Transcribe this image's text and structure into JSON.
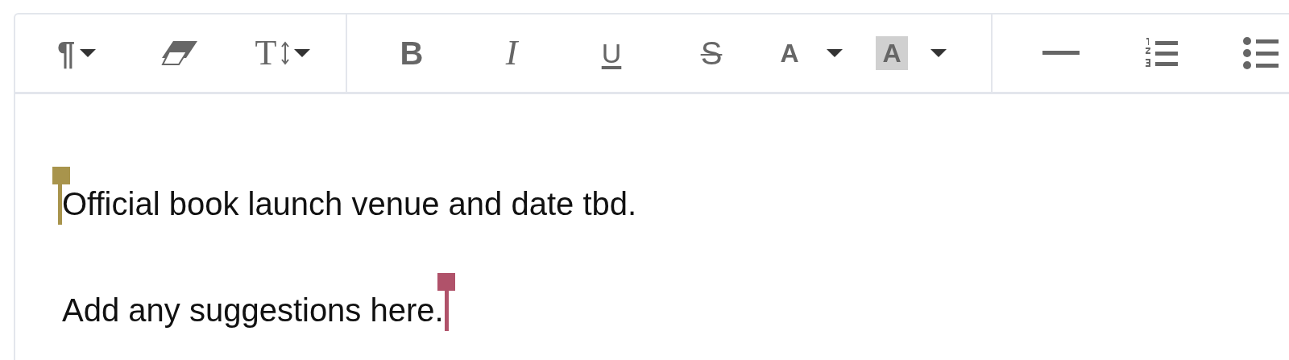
{
  "toolbar": {
    "groups": [
      {
        "buttons": [
          {
            "kind": "paragraph",
            "glyph": "¶",
            "dropdown": true
          },
          {
            "kind": "eraser",
            "dropdown": false
          },
          {
            "kind": "text-size",
            "glyph": "T",
            "dropdown": true
          }
        ]
      },
      {
        "buttons": [
          {
            "kind": "bold",
            "glyph": "B",
            "dropdown": false
          },
          {
            "kind": "italic",
            "glyph": "I",
            "dropdown": false
          },
          {
            "kind": "underline",
            "glyph": "U",
            "dropdown": false
          },
          {
            "kind": "strike",
            "glyph": "S",
            "dropdown": false
          },
          {
            "kind": "text-color",
            "glyph": "A",
            "dropdown": true
          },
          {
            "kind": "highlight",
            "glyph": "A",
            "dropdown": true
          }
        ]
      },
      {
        "buttons": [
          {
            "kind": "rule",
            "dropdown": false
          },
          {
            "kind": "numbered-list",
            "dropdown": false
          },
          {
            "kind": "bulleted-list",
            "dropdown": false
          }
        ]
      }
    ]
  },
  "document": {
    "paragraphs": [
      {
        "text": "Official book launch venue and date tbd.",
        "cursor": {
          "at_start": true,
          "color": "#a8944c"
        }
      },
      {
        "text": "Add any suggestions here.",
        "cursor": {
          "at_start": false,
          "color": "#b0526a"
        }
      }
    ]
  }
}
